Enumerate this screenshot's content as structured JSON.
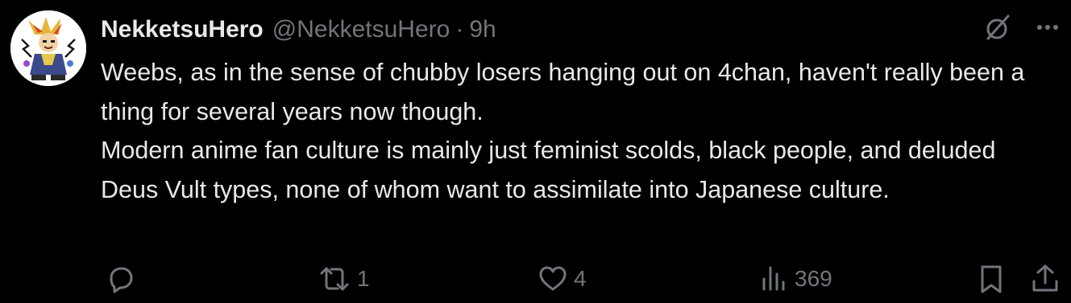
{
  "tweet": {
    "display_name": "NekketsuHero",
    "handle": "@NekketsuHero",
    "separator": "·",
    "time": "9h",
    "avatar_icon": "anime-character-avatar-icon",
    "top_icons": [
      "grok-icon",
      "more-icon"
    ],
    "text_lines": [
      "Weebs, as in the sense of chubby losers hanging out on 4chan, haven't really been a thing for several years now though.",
      "Modern anime fan culture is mainly just feminist scolds, black people, and deluded Deus Vult types, none of whom want to assimilate into Japanese culture."
    ]
  },
  "actions": {
    "reply": {
      "icon": "reply-icon",
      "count": ""
    },
    "retweet": {
      "icon": "retweet-icon",
      "count": "1"
    },
    "like": {
      "icon": "heart-icon",
      "count": "4"
    },
    "views": {
      "icon": "views-icon",
      "count": "369"
    },
    "bookmark": {
      "icon": "bookmark-icon"
    },
    "share": {
      "icon": "share-icon"
    }
  },
  "colors": {
    "background": "#000000",
    "text_primary": "#e7e9ea",
    "text_secondary": "#71767b"
  }
}
